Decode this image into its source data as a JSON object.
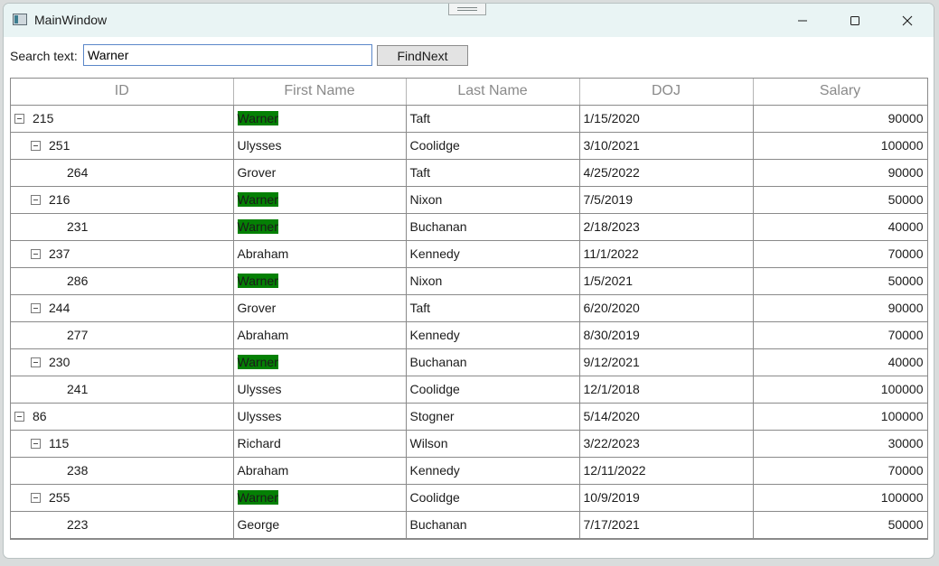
{
  "window": {
    "title": "MainWindow"
  },
  "search": {
    "label": "Search text:",
    "value": "Warner",
    "button": "FindNext"
  },
  "colors": {
    "highlight": "#048004",
    "accent": "#5b87c9"
  },
  "columns": [
    "ID",
    "First Name",
    "Last Name",
    "DOJ",
    "Salary"
  ],
  "rows": [
    {
      "level": 0,
      "expandable": true,
      "id": "215",
      "first": "Warner",
      "last": "Taft",
      "doj": "1/15/2020",
      "salary": "90000",
      "match": true
    },
    {
      "level": 1,
      "expandable": true,
      "id": "251",
      "first": "Ulysses",
      "last": "Coolidge",
      "doj": "3/10/2021",
      "salary": "100000",
      "match": false
    },
    {
      "level": 2,
      "expandable": false,
      "id": "264",
      "first": "Grover",
      "last": "Taft",
      "doj": "4/25/2022",
      "salary": "90000",
      "match": false
    },
    {
      "level": 1,
      "expandable": true,
      "id": "216",
      "first": "Warner",
      "last": "Nixon",
      "doj": "7/5/2019",
      "salary": "50000",
      "match": true
    },
    {
      "level": 2,
      "expandable": false,
      "id": "231",
      "first": "Warner",
      "last": "Buchanan",
      "doj": "2/18/2023",
      "salary": "40000",
      "match": true
    },
    {
      "level": 1,
      "expandable": true,
      "id": "237",
      "first": "Abraham",
      "last": "Kennedy",
      "doj": "11/1/2022",
      "salary": "70000",
      "match": false
    },
    {
      "level": 2,
      "expandable": false,
      "id": "286",
      "first": "Warner",
      "last": "Nixon",
      "doj": "1/5/2021",
      "salary": "50000",
      "match": true
    },
    {
      "level": 1,
      "expandable": true,
      "id": "244",
      "first": "Grover",
      "last": "Taft",
      "doj": "6/20/2020",
      "salary": "90000",
      "match": false
    },
    {
      "level": 2,
      "expandable": false,
      "id": "277",
      "first": "Abraham",
      "last": "Kennedy",
      "doj": "8/30/2019",
      "salary": "70000",
      "match": false
    },
    {
      "level": 1,
      "expandable": true,
      "id": "230",
      "first": "Warner",
      "last": "Buchanan",
      "doj": "9/12/2021",
      "salary": "40000",
      "match": true
    },
    {
      "level": 2,
      "expandable": false,
      "id": "241",
      "first": "Ulysses",
      "last": "Coolidge",
      "doj": "12/1/2018",
      "salary": "100000",
      "match": false
    },
    {
      "level": 0,
      "expandable": true,
      "id": "86",
      "first": "Ulysses",
      "last": "Stogner",
      "doj": "5/14/2020",
      "salary": "100000",
      "match": false
    },
    {
      "level": 1,
      "expandable": true,
      "id": "115",
      "first": "Richard",
      "last": "Wilson",
      "doj": "3/22/2023",
      "salary": "30000",
      "match": false
    },
    {
      "level": 2,
      "expandable": false,
      "id": "238",
      "first": "Abraham",
      "last": "Kennedy",
      "doj": "12/11/2022",
      "salary": "70000",
      "match": false
    },
    {
      "level": 1,
      "expandable": true,
      "id": "255",
      "first": "Warner",
      "last": "Coolidge",
      "doj": "10/9/2019",
      "salary": "100000",
      "match": true
    },
    {
      "level": 2,
      "expandable": false,
      "id": "223",
      "first": "George",
      "last": "Buchanan",
      "doj": "7/17/2021",
      "salary": "50000",
      "match": false
    }
  ]
}
